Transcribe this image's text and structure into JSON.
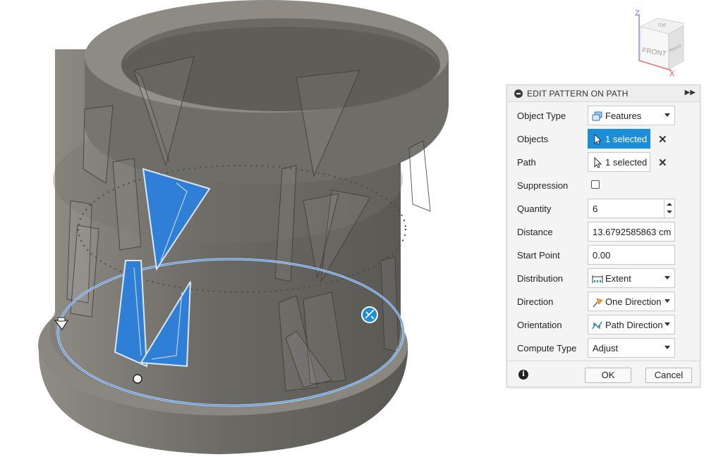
{
  "viewcube": {
    "axis_z": "Z",
    "axis_x": "X",
    "face_front": "FRONT",
    "face_right": "RIGHT",
    "face_top": "TOP"
  },
  "dialog": {
    "title": "EDIT PATTERN ON PATH",
    "rows": {
      "object_type": {
        "label": "Object Type",
        "value": "Features",
        "icon": "features-icon"
      },
      "objects": {
        "label": "Objects",
        "value": "1 selected",
        "icon": "cursor-icon"
      },
      "path": {
        "label": "Path",
        "value": "1 selected",
        "icon": "cursor-icon"
      },
      "suppression": {
        "label": "Suppression",
        "checked": false
      },
      "quantity": {
        "label": "Quantity",
        "value": "6"
      },
      "distance": {
        "label": "Distance",
        "value": "13.6792585863 cm"
      },
      "start_point": {
        "label": "Start Point",
        "value": "0.00"
      },
      "distribution": {
        "label": "Distribution",
        "value": "Extent",
        "icon": "extent-icon"
      },
      "direction": {
        "label": "Direction",
        "value": "One Direction",
        "icon": "one-direction-icon"
      },
      "orientation": {
        "label": "Orientation",
        "value": "Path Direction",
        "icon": "path-direction-icon"
      },
      "compute_type": {
        "label": "Compute Type",
        "value": "Adjust"
      }
    },
    "ok_label": "OK",
    "cancel_label": "Cancel",
    "info_glyph": "i"
  },
  "colors": {
    "accent": "#1a8ed8",
    "body": "#6e6c66",
    "selection": "#2f7fd6"
  }
}
